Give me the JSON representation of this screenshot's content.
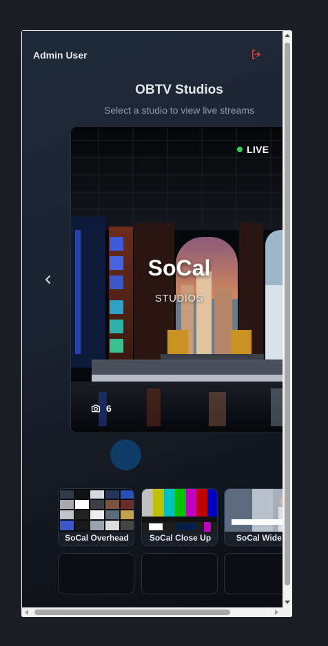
{
  "header": {
    "user_name": "Admin User",
    "logout_icon": "logout-icon"
  },
  "page": {
    "title": "OBTV Studios",
    "subtitle": "Select a studio to view live streams"
  },
  "carousel": {
    "prev_icon": "chevron-left-icon",
    "featured": {
      "title": "SoCal",
      "subtitle": "STUDIOS",
      "status": "LIVE",
      "status_color": "#36d35b",
      "camera_count": "6",
      "camera_icon": "camera-icon"
    },
    "indicator_color": "#0d4373"
  },
  "streams": [
    {
      "label": "SoCal Overhead"
    },
    {
      "label": "SoCal Close Up"
    },
    {
      "label": "SoCal Wide S"
    }
  ]
}
